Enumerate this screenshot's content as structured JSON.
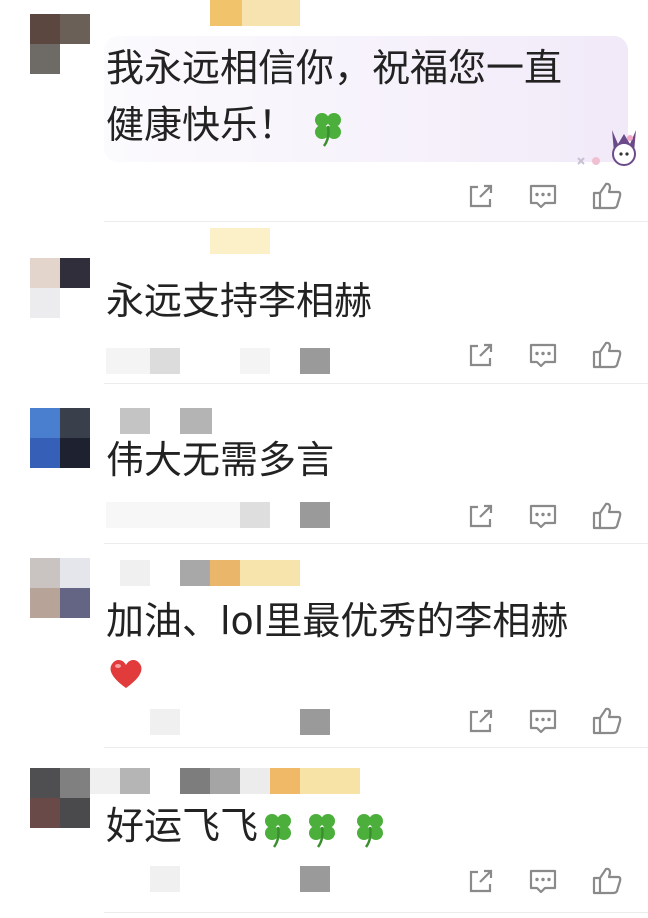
{
  "comments": [
    {
      "text_line1": "我永远相信你，祝福您一直",
      "text_line2": "健康快乐！",
      "emoji": "clover-icon"
    },
    {
      "text": "永远支持李相赫"
    },
    {
      "text": "伟大无需多言"
    },
    {
      "text_line1": "加油、lol里最优秀的李相赫",
      "emoji": "heart-icon"
    },
    {
      "text": "好运飞飞",
      "emoji": "clover-icon"
    }
  ],
  "icons": {
    "share": "share-icon",
    "comment": "comment-icon",
    "like": "like-icon"
  },
  "colors": {
    "icon": "#8a8a8a",
    "clover": "#4caf3c",
    "heart": "#e23b3b",
    "divider": "#ececec"
  }
}
